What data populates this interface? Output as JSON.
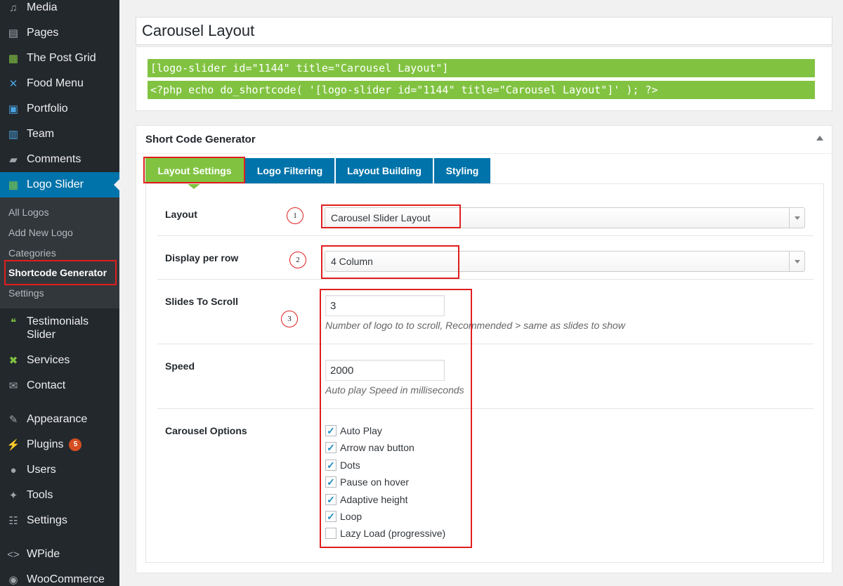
{
  "sidebar": {
    "items": [
      {
        "label": "Media",
        "icon": "media-icon"
      },
      {
        "label": "Pages",
        "icon": "pages-icon"
      },
      {
        "label": "The Post Grid",
        "icon": "grid-icon"
      },
      {
        "label": "Food Menu",
        "icon": "food-menu-icon"
      },
      {
        "label": "Portfolio",
        "icon": "portfolio-icon"
      },
      {
        "label": "Team",
        "icon": "team-icon"
      },
      {
        "label": "Comments",
        "icon": "comments-icon"
      },
      {
        "label": "Logo Slider",
        "icon": "logo-slider-icon"
      },
      {
        "label": "Testimonials Slider",
        "icon": "testimonials-icon"
      },
      {
        "label": "Services",
        "icon": "services-icon"
      },
      {
        "label": "Contact",
        "icon": "contact-icon"
      },
      {
        "label": "Appearance",
        "icon": "appearance-icon"
      },
      {
        "label": "Plugins",
        "icon": "plugins-icon",
        "badge": "5"
      },
      {
        "label": "Users",
        "icon": "users-icon"
      },
      {
        "label": "Tools",
        "icon": "tools-icon"
      },
      {
        "label": "Settings",
        "icon": "settings-icon"
      },
      {
        "label": "WPide",
        "icon": "code-icon"
      },
      {
        "label": "WooCommerce",
        "icon": "woocommerce-icon"
      }
    ],
    "submenu": [
      "All Logos",
      "Add New Logo",
      "Categories",
      "Shortcode Generator",
      "Settings"
    ]
  },
  "page": {
    "title": "Carousel Layout",
    "shortcode": "[logo-slider id=\"1144\" title=\"Carousel Layout\"]",
    "php_code": "<?php echo do_shortcode( '[logo-slider id=\"1144\" title=\"Carousel Layout\"]' ); ?>"
  },
  "generator": {
    "heading": "Short Code Generator",
    "tabs": [
      "Layout Settings",
      "Logo Filtering",
      "Layout Building",
      "Styling"
    ],
    "layout_label": "Layout",
    "layout_value": "Carousel Slider Layout",
    "display_label": "Display per row",
    "display_value": "4 Column",
    "slides_label": "Slides To Scroll",
    "slides_value": "3",
    "slides_hint": "Number of logo to to scroll, Recommended > same as slides to show",
    "speed_label": "Speed",
    "speed_value": "2000",
    "speed_hint": "Auto play Speed in milliseconds",
    "carousel_label": "Carousel Options",
    "options": [
      {
        "label": "Auto Play",
        "checked": true
      },
      {
        "label": "Arrow nav button",
        "checked": true
      },
      {
        "label": "Dots",
        "checked": true
      },
      {
        "label": "Pause on hover",
        "checked": true
      },
      {
        "label": "Adaptive height",
        "checked": true
      },
      {
        "label": "Loop",
        "checked": true
      },
      {
        "label": "Lazy Load (progressive)",
        "checked": false
      }
    ],
    "annotations": [
      "1",
      "2",
      "3"
    ]
  },
  "colors": {
    "sidebar_bg": "#23282d",
    "active_blue": "#0073aa",
    "accent_green": "#81c341",
    "highlight_red": "#e01e1e"
  }
}
